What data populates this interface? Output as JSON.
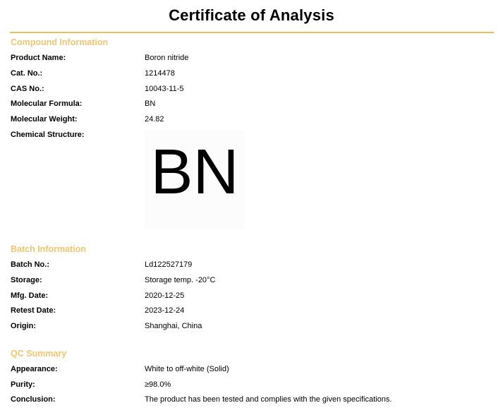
{
  "title": "Certificate of Analysis",
  "compound": {
    "heading": "Compound Information",
    "product_name_label": "Product Name:",
    "product_name": "Boron nitride",
    "cat_no_label": "Cat. No.:",
    "cat_no": "1214478",
    "cas_no_label": "CAS No.:",
    "cas_no": "10043-11-5",
    "formula_label": "Molecular Formula:",
    "formula": "BN",
    "weight_label": "Molecular Weight:",
    "weight": "24.82",
    "structure_label": "Chemical Structure:",
    "structure_text": "BN"
  },
  "batch": {
    "heading": "Batch Information",
    "batch_no_label": "Batch No.:",
    "batch_no": "Ld122527179",
    "storage_label": "Storage:",
    "storage": "Storage temp. -20°C",
    "mfg_date_label": "Mfg. Date:",
    "mfg_date": "2020-12-25",
    "retest_date_label": "Retest Date:",
    "retest_date": "2023-12-24",
    "origin_label": "Origin:",
    "origin": "Shanghai, China"
  },
  "qc": {
    "heading": "QC Summary",
    "appearance_label": "Appearance:",
    "appearance": "White to off-white (Solid)",
    "purity_label": "Purity:",
    "purity": "≥98.0%",
    "conclusion_label": "Conclusion:",
    "conclusion": "The product has been tested and complies with the given specifications."
  },
  "colors": {
    "accent": "#f2c671",
    "rule": "#e8bf5a"
  }
}
